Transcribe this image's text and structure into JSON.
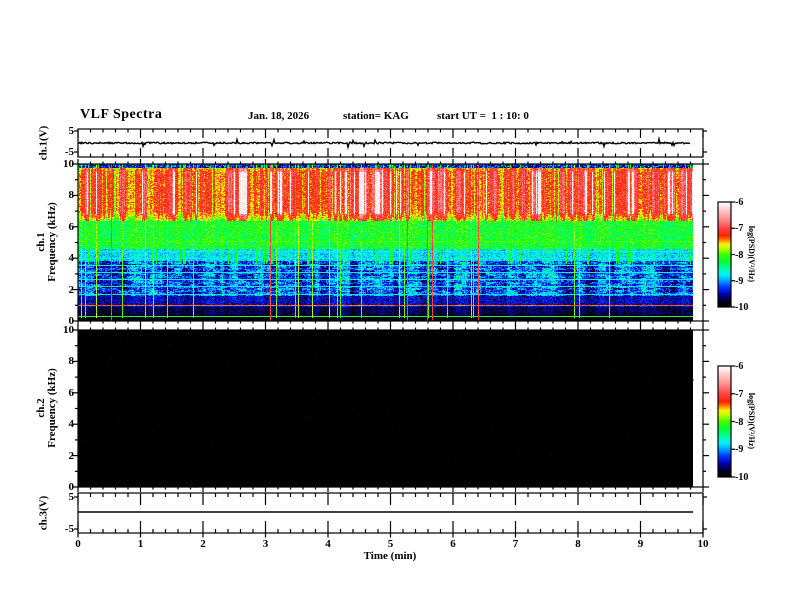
{
  "header": {
    "title": "VLF Spectra",
    "date": "Jan. 18, 2026",
    "station": "station= KAG",
    "start_ut": "start UT =  1 : 10: 0"
  },
  "panels": {
    "ch1_wave": {
      "ylabel": "ch.1(V)",
      "ytick_top": "5",
      "ytick_bottom": "-5"
    },
    "ch1_spec": {
      "ylabel_channel": "ch.1",
      "ylabel_axis": "Frequency (kHz)",
      "yticks": [
        "10",
        "8",
        "6",
        "4",
        "2",
        "0"
      ]
    },
    "ch2_spec": {
      "ylabel_channel": "ch.2",
      "ylabel_axis": "Frequency (kHz)",
      "yticks": [
        "10",
        "8",
        "6",
        "4",
        "2",
        "0"
      ]
    },
    "ch3_wave": {
      "ylabel": "ch.3(V)",
      "ytick_top": "5",
      "ytick_bottom": "-5"
    }
  },
  "xaxis": {
    "label": "Time (min)",
    "tick_labels": [
      "0",
      "1",
      "2",
      "3",
      "4",
      "5",
      "6",
      "7",
      "8",
      "9",
      "10"
    ]
  },
  "colorbars": {
    "label": "log(PSD)(V²/Hz)",
    "tick_labels": [
      "-6",
      "-7",
      "-8",
      "-9",
      "-10"
    ]
  },
  "style": {
    "frame_color": "#000000",
    "background": "#ffffff",
    "colormap": [
      [
        0.0,
        "#000000"
      ],
      [
        0.06,
        "#000033"
      ],
      [
        0.12,
        "#0000bb"
      ],
      [
        0.18,
        "#0033ff"
      ],
      [
        0.24,
        "#0099ff"
      ],
      [
        0.3,
        "#00eeff"
      ],
      [
        0.36,
        "#00ffaa"
      ],
      [
        0.43,
        "#00ff33"
      ],
      [
        0.5,
        "#44ff00"
      ],
      [
        0.565,
        "#ccff00"
      ],
      [
        0.6,
        "#ffee00"
      ],
      [
        0.64,
        "#ff7700"
      ],
      [
        0.68,
        "#ff2200"
      ],
      [
        0.75,
        "#ff4444"
      ],
      [
        0.85,
        "#ff9999"
      ],
      [
        0.93,
        "#ffcccc"
      ],
      [
        0.97,
        "#ffeeee"
      ],
      [
        1.0,
        "#ffffff"
      ]
    ]
  },
  "chart_data": [
    {
      "type": "line",
      "title": "ch.1 voltage waveform",
      "xlabel": "Time (min)",
      "ylabel": "ch.1(V)",
      "xlim": [
        0,
        10
      ],
      "ylim": [
        -5,
        5
      ],
      "x_extent": [
        0,
        9.8
      ],
      "mean_V": 0,
      "noise_amplitude_V": 0.3,
      "spike_amplitude_V": 1.5,
      "description": "continuous noisy trace hugging 0 V with small impulsive spikes"
    },
    {
      "type": "heatmap",
      "title": "ch.1 VLF spectrogram",
      "xlabel": "Time (min)",
      "ylabel": "Frequency (kHz)",
      "xlim": [
        0,
        10
      ],
      "ylim": [
        0,
        10
      ],
      "x_extent": [
        0,
        9.8
      ],
      "zlabel": "log(PSD)(V²/Hz)",
      "zlim": [
        -10,
        -6
      ],
      "bands": [
        {
          "f_khz": [
            9.72,
            10.0
          ],
          "log_psd": -9.6,
          "noise_v": 0.2,
          "texture": "dark_speckle"
        },
        {
          "f_khz": [
            6.4,
            9.72
          ],
          "log_psd": -7.2,
          "noise_v": 0.12,
          "texture": "striated"
        },
        {
          "f_khz": [
            4.6,
            6.4
          ],
          "log_psd": -8.2,
          "noise_v": 0.14,
          "texture": "smooth"
        },
        {
          "f_khz": [
            3.8,
            4.6
          ],
          "log_psd": -8.8,
          "noise_v": 0.14,
          "texture": "smooth"
        },
        {
          "f_khz": [
            1.6,
            3.8
          ],
          "log_psd": -9.2,
          "noise_v": 0.18,
          "texture": "blocky"
        },
        {
          "f_khz": [
            0.9,
            1.6
          ],
          "log_psd": -9.5,
          "noise_v": 0.12,
          "texture": "smooth"
        },
        {
          "f_khz": [
            0.4,
            0.9
          ],
          "log_psd": -9.75,
          "noise_v": 0.1,
          "texture": "smooth"
        },
        {
          "f_khz": [
            0.0,
            0.4
          ],
          "log_psd": -9.9,
          "noise_v": 0.06,
          "texture": "smooth"
        }
      ],
      "narrowband_lines": [
        {
          "f_khz": 5.1,
          "log_psd": -8.0
        },
        {
          "f_khz": 4.45,
          "log_psd": -8.7
        },
        {
          "f_khz": 4.0,
          "log_psd": -8.7
        },
        {
          "f_khz": 3.55,
          "log_psd": -8.7
        },
        {
          "f_khz": 3.1,
          "log_psd": -8.75
        },
        {
          "f_khz": 2.65,
          "log_psd": -8.75
        },
        {
          "f_khz": 2.2,
          "log_psd": -8.8
        },
        {
          "f_khz": 1.75,
          "log_psd": -8.8
        },
        {
          "f_khz": 1.05,
          "log_psd": -7.4
        },
        {
          "f_khz": 0.35,
          "log_psd": -8.1
        }
      ],
      "sferics": {
        "strong_log_psd": -7.9,
        "intense_log_psd": -7.0,
        "description": "dense vertical sferic striations between 6.4 and 9.7 kHz reaching -6 (white), many extending to 0 kHz"
      }
    },
    {
      "type": "heatmap",
      "title": "ch.2 VLF spectrogram",
      "xlabel": "Time (min)",
      "ylabel": "Frequency (kHz)",
      "xlim": [
        0,
        10
      ],
      "ylim": [
        0,
        10
      ],
      "x_extent": [
        0,
        9.8
      ],
      "zlabel": "log(PSD)(V²/Hz)",
      "zlim": [
        -10,
        -6
      ],
      "bands": [
        {
          "f_khz": [
            0,
            10
          ],
          "log_psd": -10,
          "noise_v": 0.0,
          "texture": "smooth"
        }
      ],
      "description": "no signal: entire panel at or below -10 (black)"
    },
    {
      "type": "line",
      "title": "ch.3 voltage waveform",
      "xlabel": "Time (min)",
      "ylabel": "ch.3(V)",
      "xlim": [
        0,
        10
      ],
      "ylim": [
        -5,
        5
      ],
      "x_extent": [
        0,
        9.8
      ],
      "mean_V": 0.3,
      "noise_amplitude_V": 0,
      "description": "perfectly flat constant trace"
    }
  ]
}
